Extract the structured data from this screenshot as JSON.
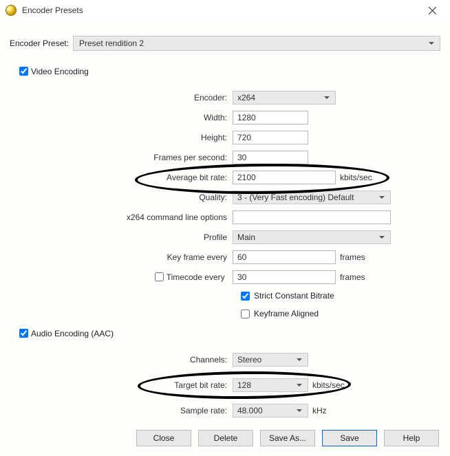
{
  "window": {
    "title": "Encoder Presets"
  },
  "preset": {
    "label": "Encoder Preset:",
    "selected": "Preset rendition 2"
  },
  "video": {
    "section_label": "Video Encoding",
    "section_checked": true,
    "encoder_label": "Encoder:",
    "encoder_value": "x264",
    "width_label": "Width:",
    "width_value": "1280",
    "height_label": "Height:",
    "height_value": "720",
    "fps_label": "Frames per second:",
    "fps_value": "30",
    "avg_bitrate_label": "Average bit rate:",
    "avg_bitrate_value": "2100",
    "avg_bitrate_unit": "kbits/sec",
    "quality_label": "Quality:",
    "quality_value": "3 - (Very Fast encoding) Default",
    "cmdline_label": "x264 command line options",
    "cmdline_value": "",
    "profile_label": "Profile",
    "profile_value": "Main",
    "keyframe_label": "Key frame every",
    "keyframe_value": "60",
    "keyframe_unit": "frames",
    "timecode_label": "Timecode every",
    "timecode_checked": false,
    "timecode_value": "30",
    "timecode_unit": "frames",
    "strict_cbr_label": "Strict Constant Bitrate",
    "strict_cbr_checked": true,
    "kf_aligned_label": "Keyframe Aligned",
    "kf_aligned_checked": false
  },
  "audio": {
    "section_label": "Audio Encoding (AAC)",
    "section_checked": true,
    "channels_label": "Channels:",
    "channels_value": "Stereo",
    "target_bitrate_label": "Target bit rate:",
    "target_bitrate_value": "128",
    "target_bitrate_unit": "kbits/sec",
    "sample_rate_label": "Sample rate:",
    "sample_rate_value": "48.000",
    "sample_rate_unit": "kHz"
  },
  "buttons": {
    "close": "Close",
    "delete": "Delete",
    "save_as": "Save As...",
    "save": "Save",
    "help": "Help"
  }
}
